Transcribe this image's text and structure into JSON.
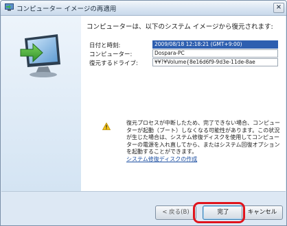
{
  "window": {
    "title": "コンピューター イメージの再適用",
    "close_glyph": "×"
  },
  "main": {
    "heading": "コンピューターは、以下のシステム イメージから復元されます:",
    "rows": [
      {
        "label": "日付と時刻:",
        "value": "2009/08/18 12:18:21 (GMT+9:00)",
        "selected": true
      },
      {
        "label": "コンピューター:",
        "value": "Dospara-PC",
        "selected": false
      },
      {
        "label": "復元するドライブ:",
        "value": "¥¥?¥Volume{8e16d6f9-9d3e-11de-8ae",
        "selected": false
      }
    ],
    "warning_text": "復元プロセスが中断したため、完了できない場合、コンピューターが起動（ブート）しなくなる可能性があります。この状況が生じた場合は、システム修復ディスクを使用してコンピューターの電源を入れ直してから、またはシステム回復オプションを起動することができます。",
    "warning_link": "システム修復ディスクの作成"
  },
  "footer": {
    "back_label": "< 戻る(B)",
    "finish_label": "完了",
    "cancel_label": "キャンセル"
  },
  "colors": {
    "highlight": "#e0141c",
    "selection": "#2e5fb0"
  }
}
